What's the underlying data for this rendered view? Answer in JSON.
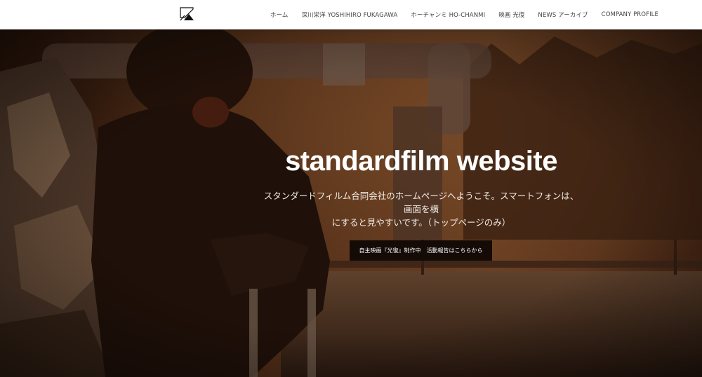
{
  "site": {
    "logo_icon": "standardfilm-logo-icon"
  },
  "nav": {
    "items": [
      {
        "label": "ホーム"
      },
      {
        "label": "深川栄洋 YOSHIHIRO FUKAGAWA"
      },
      {
        "label": "ホーチャンミ HO-CHANMI"
      },
      {
        "label": "映画 光復"
      },
      {
        "label": "NEWS アーカイブ"
      },
      {
        "label": "COMPANY PROFILE"
      }
    ]
  },
  "hero": {
    "title": "standardfilm website",
    "description_line1": "スタンダードフィルム合同会社のホームページへようこそ。スマートフォンは、画面を横",
    "description_line2": "にすると見やすいです。（トップページのみ）",
    "button_label": "自主映画『光復』制作中　活動報告はこちらから"
  },
  "colors": {
    "header_bg": "#ffffff",
    "nav_text": "#444444",
    "hero_tint": "#3a1e10",
    "button_bg": "#140a06"
  }
}
